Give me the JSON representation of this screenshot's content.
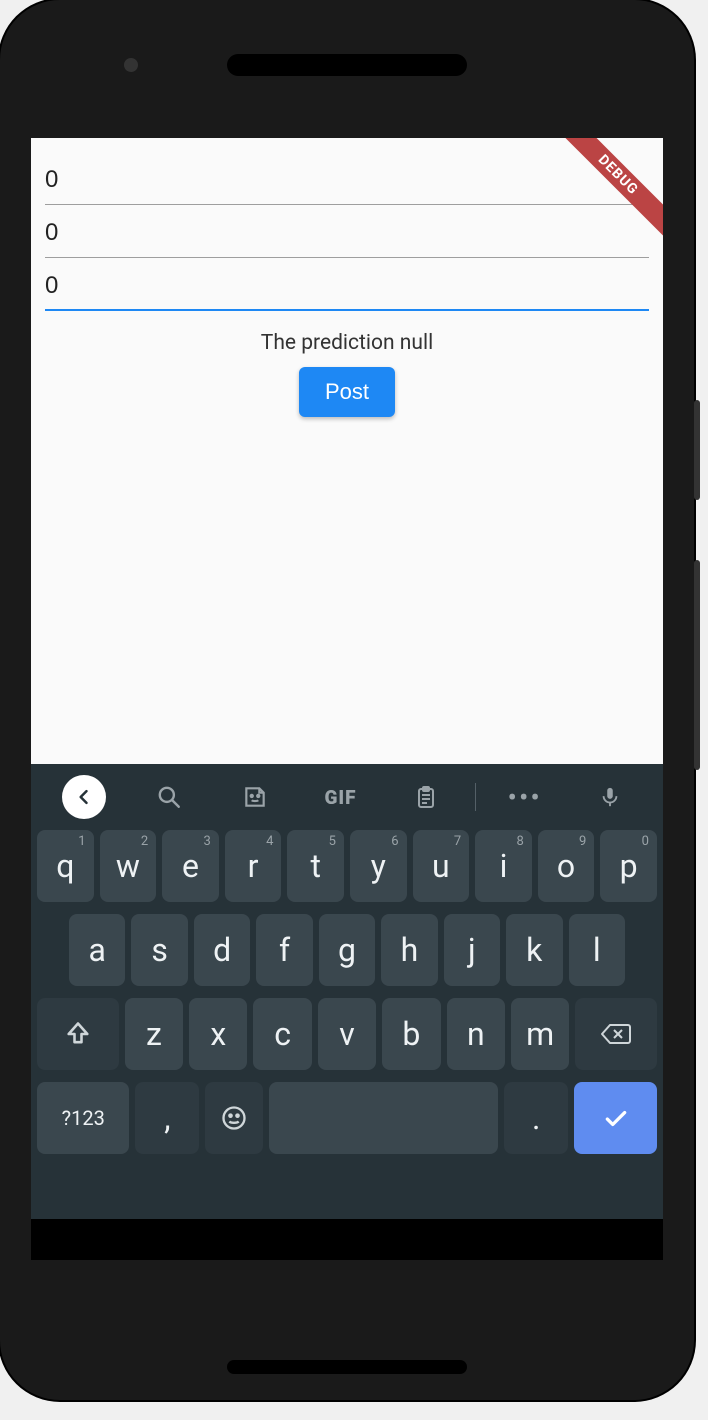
{
  "debug_label": "DEBUG",
  "inputs": [
    {
      "value": "0",
      "active": false
    },
    {
      "value": "0",
      "active": false
    },
    {
      "value": "0",
      "active": true
    }
  ],
  "prediction_text": "The prediction null",
  "post_button_label": "Post",
  "keyboard": {
    "toolbar": {
      "back": "‹",
      "gif_label": "GIF"
    },
    "row1": [
      {
        "c": "q",
        "n": "1"
      },
      {
        "c": "w",
        "n": "2"
      },
      {
        "c": "e",
        "n": "3"
      },
      {
        "c": "r",
        "n": "4"
      },
      {
        "c": "t",
        "n": "5"
      },
      {
        "c": "y",
        "n": "6"
      },
      {
        "c": "u",
        "n": "7"
      },
      {
        "c": "i",
        "n": "8"
      },
      {
        "c": "o",
        "n": "9"
      },
      {
        "c": "p",
        "n": "0"
      }
    ],
    "row2": [
      "a",
      "s",
      "d",
      "f",
      "g",
      "h",
      "j",
      "k",
      "l"
    ],
    "row3": [
      "z",
      "x",
      "c",
      "v",
      "b",
      "n",
      "m"
    ],
    "row4": {
      "symbols": "?123",
      "comma": ",",
      "space": " ",
      "period": "."
    }
  }
}
